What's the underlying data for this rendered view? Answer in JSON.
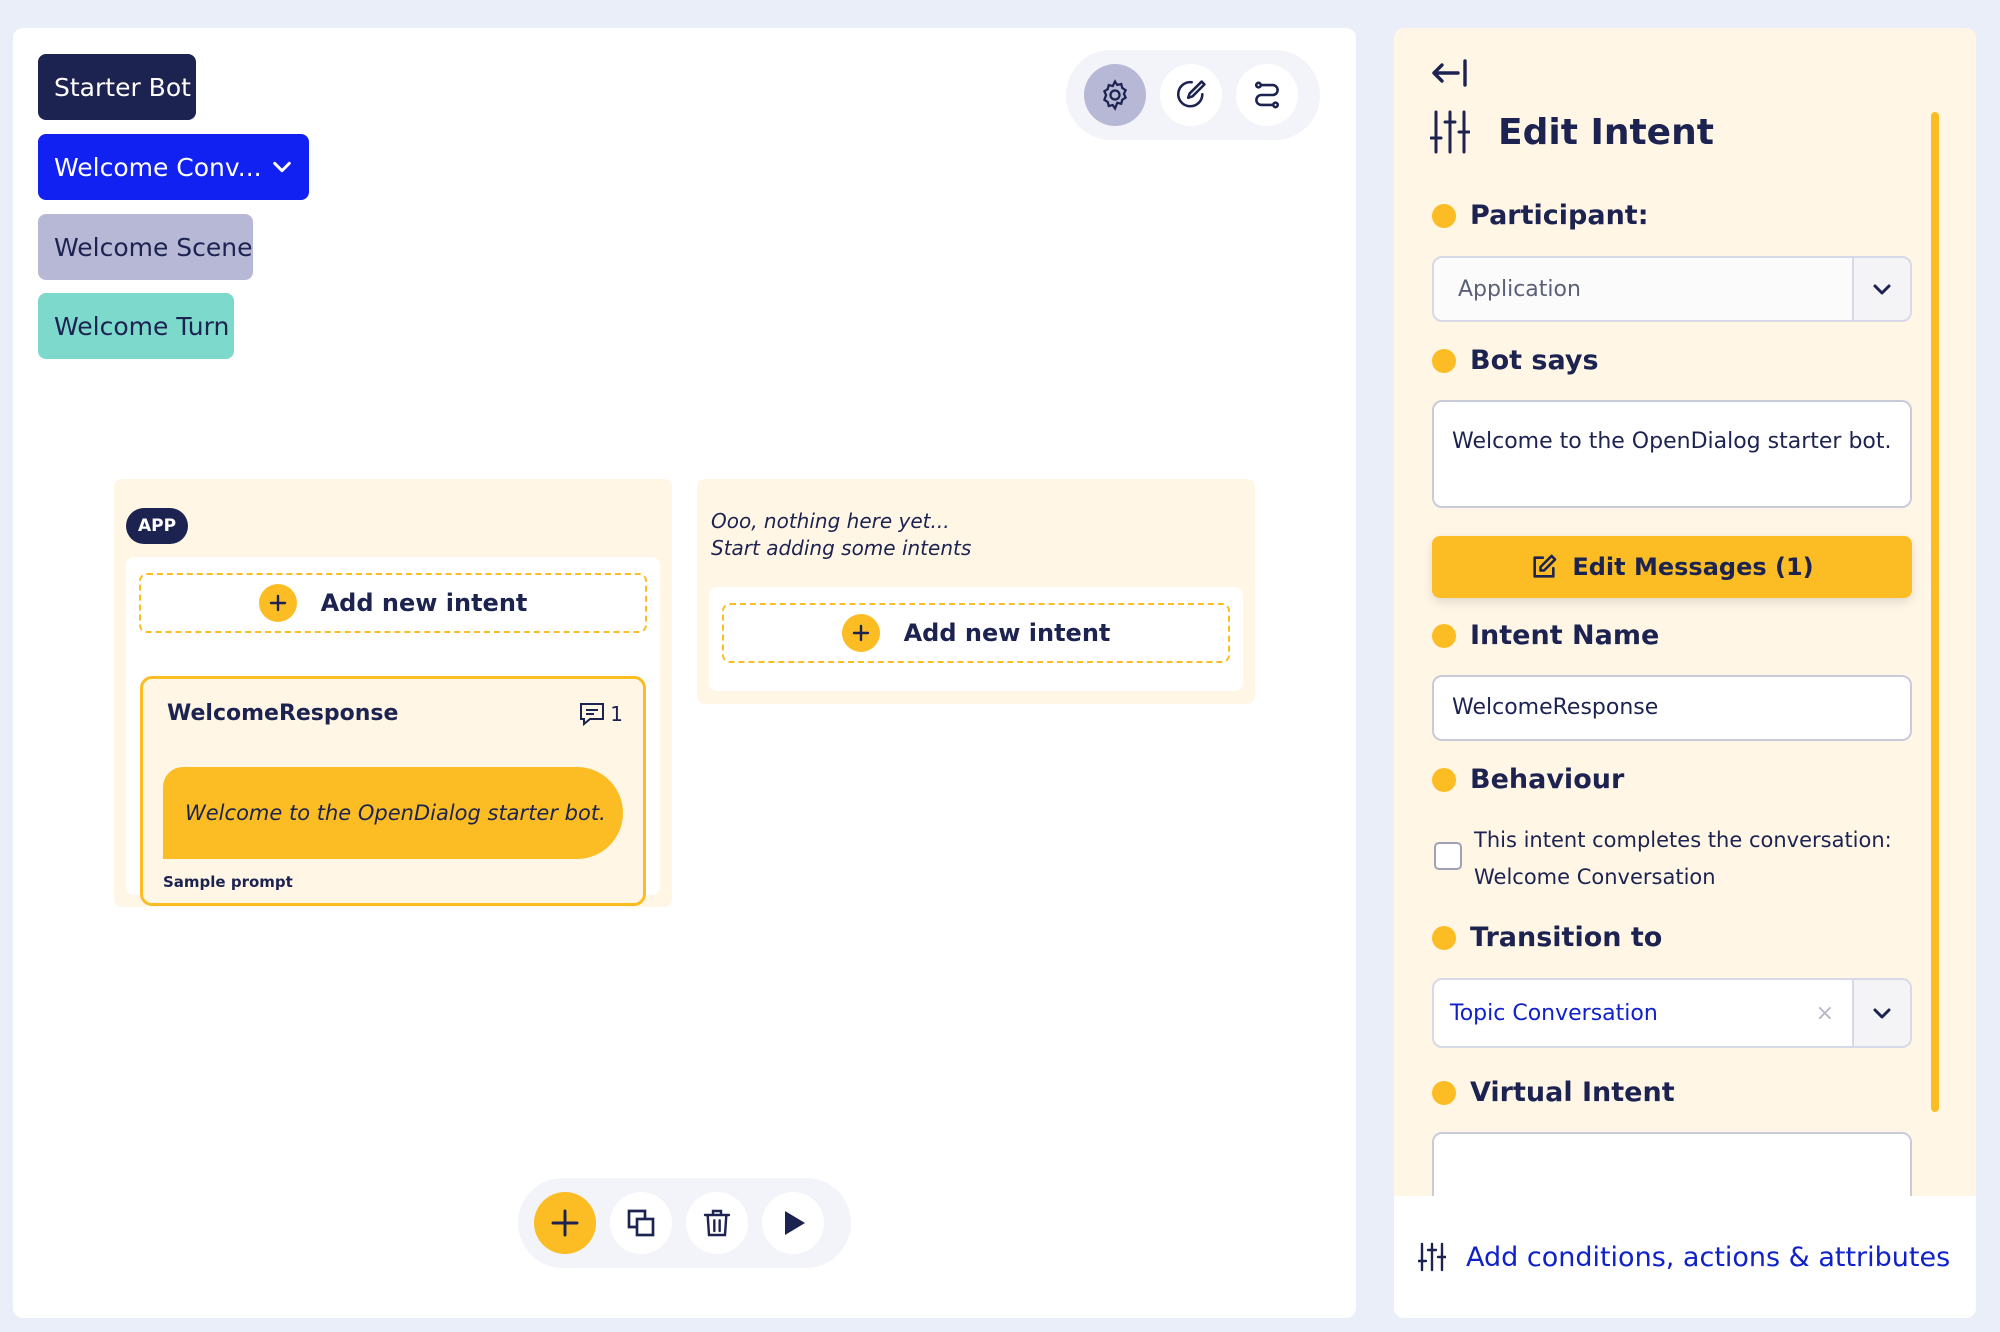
{
  "breadcrumbs": {
    "bot": "Starter Bot",
    "conversation": "Welcome Conv...",
    "scene": "Welcome Scene",
    "turn": "Welcome Turn"
  },
  "view_toggle": {
    "icons": [
      "settings-icon",
      "edit-icon",
      "route-icon"
    ],
    "active": "settings-icon"
  },
  "columns": {
    "app": {
      "badge": "APP",
      "add_label": "Add new intent",
      "intent": {
        "name": "WelcomeResponse",
        "message_count": "1",
        "message": "Welcome to the OpenDialog starter bot.",
        "footer": "Sample prompt"
      }
    },
    "user": {
      "empty_line1": "Ooo, nothing here yet...",
      "empty_line2": "Start adding some intents",
      "add_label": "Add new intent"
    }
  },
  "bottom_toolbar": {
    "icons": [
      "add-icon",
      "duplicate-icon",
      "delete-icon",
      "play-icon"
    ]
  },
  "panel": {
    "title": "Edit Intent",
    "participant_label": "Participant:",
    "participant_value": "Application",
    "bot_says_label": "Bot says",
    "bot_says_value": "Welcome to the OpenDialog starter bot.",
    "edit_messages_label": "Edit Messages (1)",
    "intent_name_label": "Intent Name",
    "intent_name_value": "WelcomeResponse",
    "behaviour_label": "Behaviour",
    "behaviour_line1": "This intent completes the conversation:",
    "behaviour_line2": "Welcome Conversation",
    "transition_label": "Transition to",
    "transition_value": "Topic Conversation",
    "transition_clear": "×",
    "virtual_intent_label": "Virtual Intent",
    "virtual_intent_value": "",
    "footer_link": "Add conditions, actions & attributes"
  },
  "colors": {
    "navy": "#1c2350",
    "blue": "#1021f2",
    "scene": "#b7b8d5",
    "turn": "#7dd9cb",
    "accent": "#fbbd23",
    "panel_bg": "#fff6e6"
  }
}
